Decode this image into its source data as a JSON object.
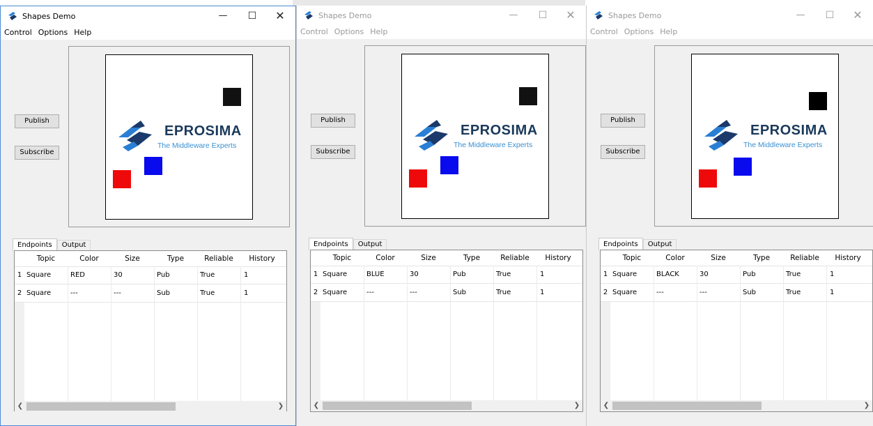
{
  "windows": [
    {
      "title": "Shapes Demo",
      "active": true,
      "menu": [
        "Control",
        "Options",
        "Help"
      ],
      "buttons": {
        "publish": "Publish",
        "subscribe": "Subscribe"
      },
      "logo": {
        "name": "EPROSIMA",
        "tagline": "The Middleware Experts"
      },
      "shapes": [
        {
          "color": "#111111",
          "label": "black square"
        },
        {
          "color": "#0a0aee",
          "label": "blue square"
        },
        {
          "color": "#ee0a0a",
          "label": "red square"
        }
      ],
      "tabs": [
        "Endpoints",
        "Output"
      ],
      "table": {
        "headers": [
          "Topic",
          "Color",
          "Size",
          "Type",
          "Reliable",
          "History"
        ],
        "rows": [
          {
            "num": "1",
            "cells": [
              "Square",
              "RED",
              "30",
              "Pub",
              "True",
              "1"
            ]
          },
          {
            "num": "2",
            "cells": [
              "Square",
              "---",
              "---",
              "Sub",
              "True",
              "1"
            ]
          }
        ]
      }
    },
    {
      "title": "Shapes Demo",
      "active": false,
      "menu": [
        "Control",
        "Options",
        "Help"
      ],
      "buttons": {
        "publish": "Publish",
        "subscribe": "Subscribe"
      },
      "logo": {
        "name": "EPROSIMA",
        "tagline": "The Middleware Experts"
      },
      "shapes": [
        {
          "color": "#111111",
          "label": "black square"
        },
        {
          "color": "#0a0aee",
          "label": "blue square"
        },
        {
          "color": "#ee0a0a",
          "label": "red square"
        }
      ],
      "tabs": [
        "Endpoints",
        "Output"
      ],
      "table": {
        "headers": [
          "Topic",
          "Color",
          "Size",
          "Type",
          "Reliable",
          "History"
        ],
        "rows": [
          {
            "num": "1",
            "cells": [
              "Square",
              "BLUE",
              "30",
              "Pub",
              "True",
              "1"
            ]
          },
          {
            "num": "2",
            "cells": [
              "Square",
              "---",
              "---",
              "Sub",
              "True",
              "1"
            ]
          }
        ]
      }
    },
    {
      "title": "Shapes Demo",
      "active": false,
      "menu": [
        "Control",
        "Options",
        "Help"
      ],
      "buttons": {
        "publish": "Publish",
        "subscribe": "Subscribe"
      },
      "logo": {
        "name": "EPROSIMA",
        "tagline": "The Middleware Experts"
      },
      "shapes": [
        {
          "color": "#000000",
          "label": "black square"
        },
        {
          "color": "#0a0aee",
          "label": "blue square"
        },
        {
          "color": "#ee0a0a",
          "label": "red square"
        }
      ],
      "tabs": [
        "Endpoints",
        "Output"
      ],
      "table": {
        "headers": [
          "Topic",
          "Color",
          "Size",
          "Type",
          "Reliable",
          "History"
        ],
        "rows": [
          {
            "num": "1",
            "cells": [
              "Square",
              "BLACK",
              "30",
              "Pub",
              "True",
              "1"
            ]
          },
          {
            "num": "2",
            "cells": [
              "Square",
              "---",
              "---",
              "Sub",
              "True",
              "1"
            ]
          }
        ]
      }
    }
  ]
}
